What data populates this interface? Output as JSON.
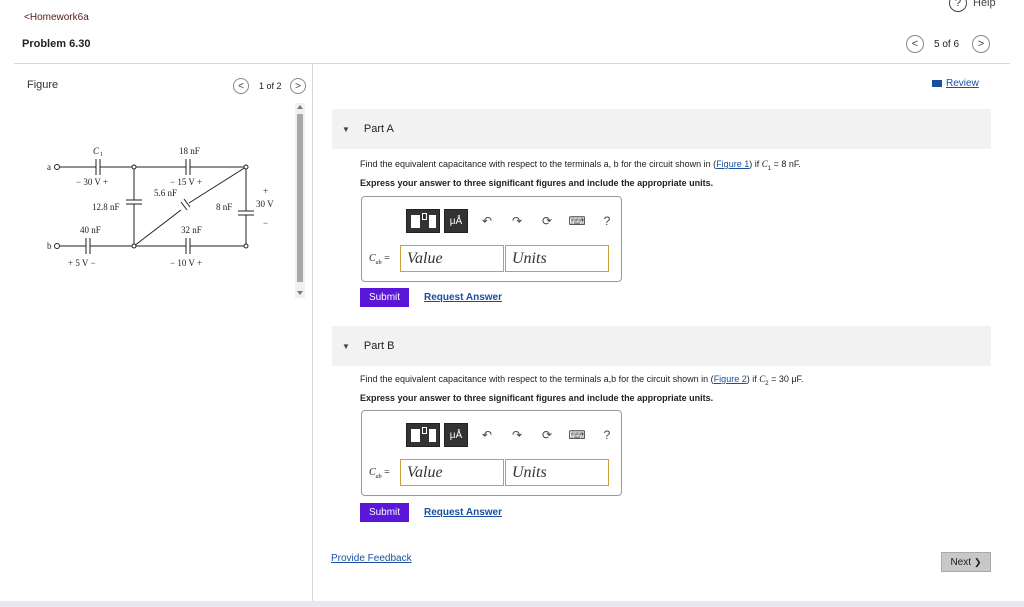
{
  "header": {
    "back_link": "Homework6a",
    "back_glyph": "<",
    "help": "Help",
    "problem_title": "Problem 6.30",
    "prev_glyph": "<",
    "next_glyph": ">",
    "pager": "5 of 6"
  },
  "figure": {
    "heading": "Figure",
    "pager": "1 of 2",
    "labels": {
      "a": "a",
      "b": "b",
      "c1": "C",
      "c1_sub": "1",
      "c18": "18 nF",
      "v30a": "−  30 V  +",
      "v15": "−  15 V  +",
      "c56": "5.6 nF",
      "c128": "12.8 nF",
      "c8": "8 nF",
      "v30b": "30 V",
      "plus": "+",
      "minus": "−",
      "c40": "40 nF",
      "c32": "32 nF",
      "v5": "+  5 V  −",
      "v10": "−  10 V  +"
    }
  },
  "review": "Review",
  "parts": [
    {
      "title": "Part A",
      "question_pre": "Find the equivalent capacitance with respect to the terminals a, b for the circuit shown in (",
      "figure_link": "Figure 1",
      "question_post": ") if ",
      "cond": "C",
      "cond_sub": "1",
      "cond_val": " = 8 nF.",
      "instruction": "Express your answer to three significant figures and include the appropriate units.",
      "label": "C",
      "label_sub": "ab",
      "label_eq": " =",
      "value_placeholder": "Value",
      "units_placeholder": "Units",
      "submit": "Submit",
      "request": "Request Answer"
    },
    {
      "title": "Part B",
      "question_pre": "Find the equivalent capacitance with respect to the terminals a,b for the circuit shown in (",
      "figure_link": "Figure 2",
      "question_post": ") if ",
      "cond": "C",
      "cond_sub": "2",
      "cond_val": " = 30 μF.",
      "instruction": "Express your answer to three significant figures and include the appropriate units.",
      "label": "C",
      "label_sub": "ab",
      "label_eq": " =",
      "value_placeholder": "Value",
      "units_placeholder": "Units",
      "submit": "Submit",
      "request": "Request Answer"
    }
  ],
  "toolbar": {
    "mu": "μÅ",
    "undo": "↶",
    "redo": "↷",
    "reset": "⟳",
    "keyboard": "⌨",
    "help": "?"
  },
  "footer": {
    "feedback": "Provide Feedback",
    "next": "Next"
  },
  "next_glyph": "❯",
  "colors": {
    "submit": "#5a17d8",
    "link": "#1a4fa0",
    "field_border": "#c8a03c",
    "back_link": "#5a1a1a"
  }
}
